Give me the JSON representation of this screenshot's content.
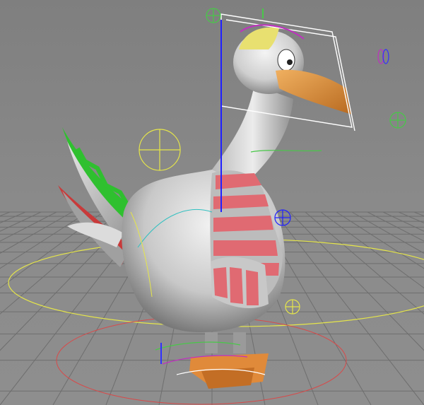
{
  "viewport": {
    "background": "#8b8b8b",
    "grid_color": "#6e6e6e",
    "grid_visible": true
  },
  "character": {
    "body_color": "#d6d6d6",
    "shade_color": "#7a7a7a",
    "beak_color": "#e39a4a",
    "feet_color": "#e08a3a",
    "crest_color": "#e8e070",
    "sweater_color": "#e06a72",
    "tail_color": "#2fc02f"
  },
  "rig_colors": {
    "control_yellow": "#e5e54a",
    "control_green": "#48c848",
    "control_blue": "#2020ff",
    "control_red": "#d04040",
    "control_magenta": "#c030c0",
    "control_white": "#ffffff",
    "control_cyan": "#30c0c0"
  },
  "icons": {
    "pivot_marker": "crosshair-circle",
    "fk_control": "circle-cross",
    "ik_box": "box-wire"
  }
}
